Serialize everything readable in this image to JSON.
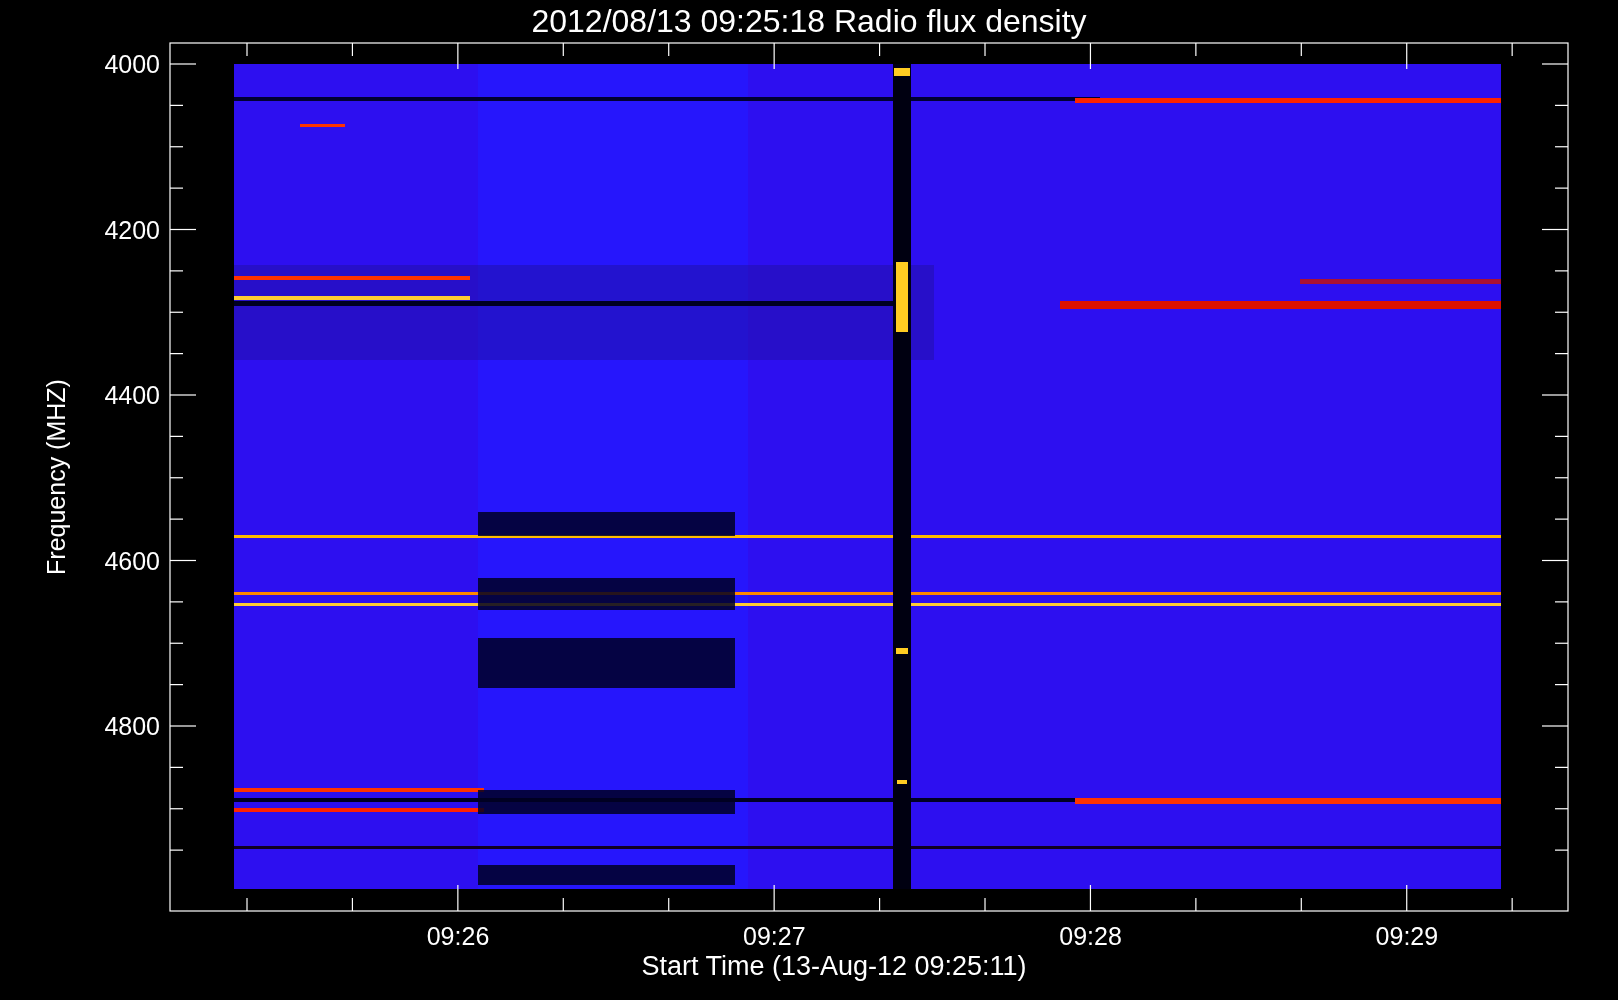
{
  "title": "2012/08/13 09:25:18 Radio flux density",
  "y_axis": {
    "label": "Frequency (MHZ)",
    "ticks": [
      "4000",
      "4200",
      "4400",
      "4600",
      "4800"
    ]
  },
  "x_axis": {
    "label": "Start Time (13-Aug-12 09:25:11)",
    "ticks": [
      "09:26",
      "09:27",
      "09:28",
      "09:29"
    ]
  }
}
